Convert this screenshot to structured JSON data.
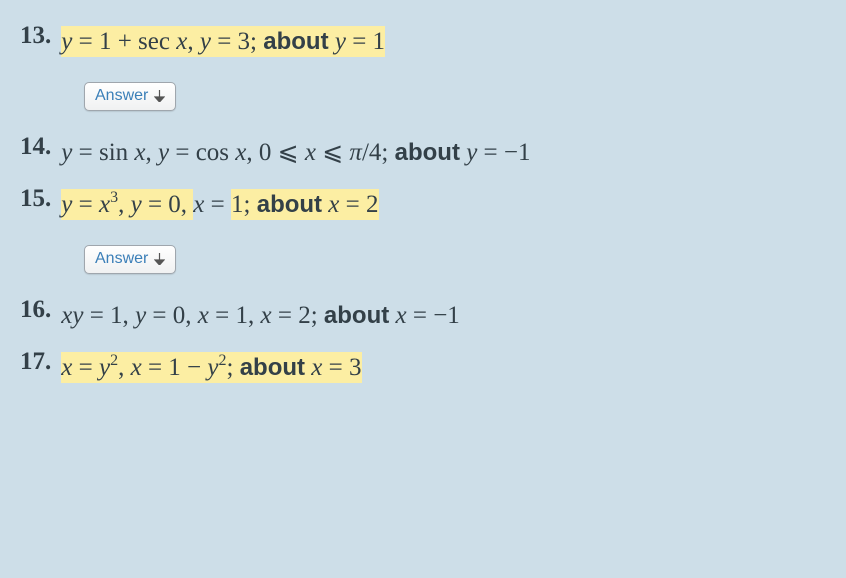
{
  "problems": {
    "p13": {
      "number": "13.",
      "equation_html": "<span class='hl'><span>y</span> <span class='rm'>= 1 + sec</span> <span>x</span><span class='rm'>,</span> <span>y</span> <span class='rm'>= 3;</span> <span class='about'>about</span> <span>y</span> <span class='rm'>= 1</span></span>",
      "highlighted": true
    },
    "p14": {
      "number": "14.",
      "equation_html": "<span>y</span> <span class='rm'>= sin</span> <span>x</span><span class='rm'>,</span> <span>y</span> <span class='rm'>= cos</span> <span>x</span><span class='rm'>, 0</span> <span class='leq'>⩽</span> <span>x</span> <span class='leq'>⩽</span> <span>π</span><span class='rm'>/4;</span> <span class='about'>about</span> <span>y</span> <span class='rm'>= −1</span>",
      "highlighted": false
    },
    "p15": {
      "number": "15.",
      "equation_html": "<span class='hl'><span>y</span> <span class='rm'>=</span> <span>x</span><span class='sup'><span class='rm'>3</span></span><span class='rm'>,</span> <span>y</span> <span class='rm'>= 0,</span> </span><span>x</span> <span class='rm'>=</span> <span class='hl'><span class='rm'>1;</span> <span class='about'>about</span> <span>x</span> <span class='rm'>= 2</span></span>",
      "highlighted": true
    },
    "p16": {
      "number": "16.",
      "equation_html": "<span>xy</span> <span class='rm'>= 1,</span> <span>y</span> <span class='rm'>= 0,</span> <span>x</span> <span class='rm'>= 1,</span> <span>x</span> <span class='rm'>= 2;</span> <span class='about'>about</span> <span>x</span> <span class='rm'>= −1</span>",
      "highlighted": false
    },
    "p17": {
      "number": "17.",
      "equation_html": "<span class='hl'><span>x</span> <span class='rm'>=</span> <span>y</span><span class='sup'><span class='rm'>2</span></span><span class='rm'>,</span> <span>x</span> <span class='rm'>= 1 −</span> <span>y</span><span class='sup'><span class='rm'>2</span></span><span class='rm'>;</span> <span class='about'>about</span> <span>x</span> <span class='rm'>= 3</span></span>",
      "highlighted": true
    }
  },
  "answer_button": {
    "label": "Answer"
  }
}
